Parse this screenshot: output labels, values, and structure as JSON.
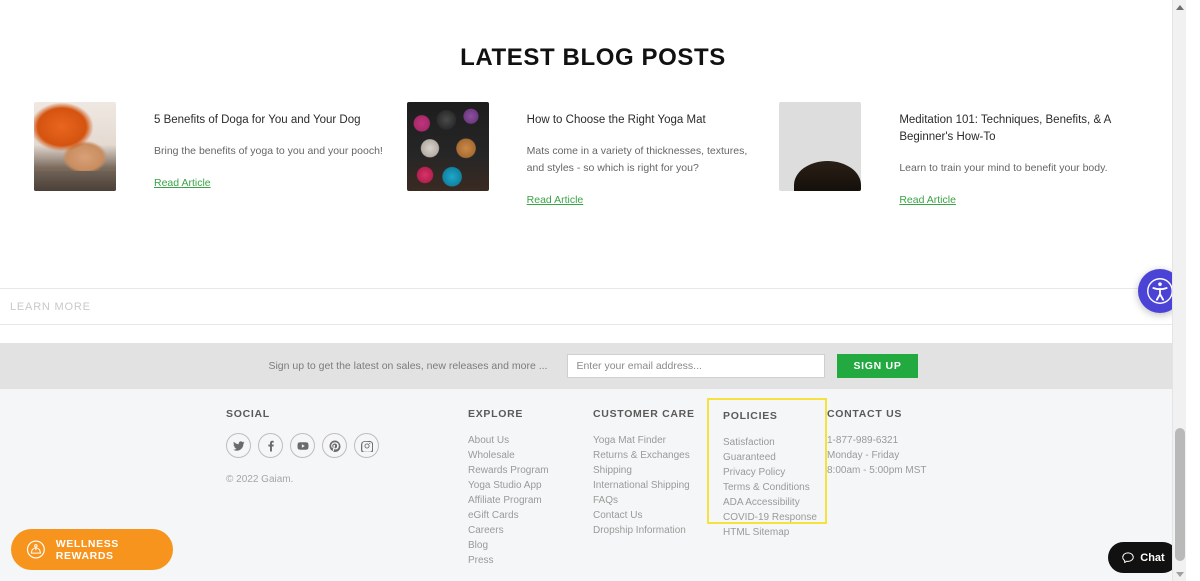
{
  "blog": {
    "heading": "LATEST BLOG POSTS",
    "posts": [
      {
        "title": "5 Benefits of Doga for You and Your Dog",
        "excerpt": "Bring the benefits of yoga to you and your pooch!",
        "link_label": "Read Article",
        "image_name": "doga-thumbnail"
      },
      {
        "title": "How to Choose the Right Yoga Mat",
        "excerpt": "Mats come in a variety of thicknesses, textures, and styles - so which is right for you?",
        "link_label": "Read Article",
        "image_name": "yoga-mats-thumbnail"
      },
      {
        "title": "Meditation 101: Techniques, Benefits, & A Beginner's How-To",
        "excerpt": "Learn to train your mind to benefit your body.",
        "link_label": "Read Article",
        "image_name": "meditation-thumbnail"
      }
    ]
  },
  "learn_more": {
    "label": "LEARN MORE"
  },
  "newsletter": {
    "label": "Sign up to get the latest on sales, new releases and more ...",
    "placeholder": "Enter your email address...",
    "button_label": "SIGN UP",
    "button_color": "#22a93f"
  },
  "footer": {
    "social": {
      "heading": "SOCIAL",
      "icons": [
        {
          "name": "twitter-icon",
          "label": "Twitter"
        },
        {
          "name": "facebook-icon",
          "label": "Facebook"
        },
        {
          "name": "youtube-icon",
          "label": "YouTube"
        },
        {
          "name": "pinterest-icon",
          "label": "Pinterest"
        },
        {
          "name": "instagram-icon",
          "label": "Instagram"
        }
      ],
      "copyright": "© 2022 Gaiam."
    },
    "explore": {
      "heading": "EXPLORE",
      "links": [
        "About Us",
        "Wholesale",
        "Rewards Program",
        "Yoga Studio App",
        "Affiliate Program",
        "eGift Cards",
        "Careers",
        "Blog",
        "Press"
      ]
    },
    "customer_care": {
      "heading": "CUSTOMER CARE",
      "links": [
        "Yoga Mat Finder",
        "Returns & Exchanges",
        "Shipping",
        "International Shipping",
        "FAQs",
        "Contact Us",
        "Dropship Information"
      ]
    },
    "policies": {
      "heading": "POLICIES",
      "highlight_color": "#f5e23f",
      "links": [
        "Satisfaction Guaranteed",
        "Privacy Policy",
        "Terms & Conditions",
        "ADA Accessibility",
        "COVID-19 Response",
        "HTML Sitemap"
      ]
    },
    "contact": {
      "heading": "CONTACT US",
      "lines": [
        "1-877-989-6321",
        "Monday - Friday",
        "8:00am - 5:00pm MST"
      ]
    }
  },
  "widgets": {
    "accessibility": {
      "icon": "accessibility-icon",
      "color": "#4a43d6"
    },
    "wellness_rewards": {
      "label": "WELLNESS REWARDS",
      "icon": "lotus-badge-icon",
      "color": "#f7941d"
    },
    "chat": {
      "label": "Chat",
      "icon": "chat-bubble-icon",
      "color": "#111111"
    }
  }
}
